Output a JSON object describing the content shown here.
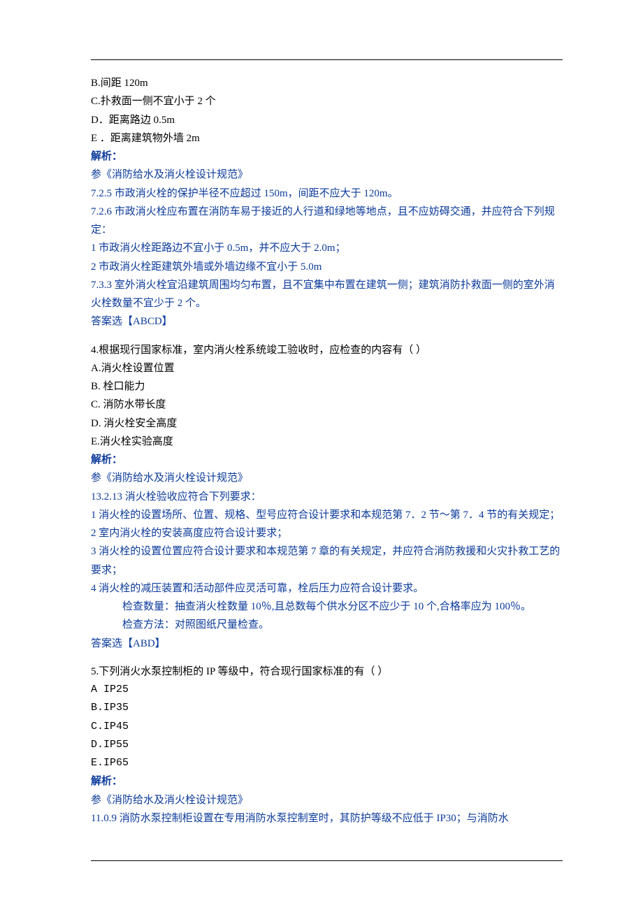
{
  "q3": {
    "optB": "B.间距 120m",
    "optC": "C.扑救面一侧不宜小于 2 个",
    "optD": "D．距离路边 0.5m",
    "optE": "E ．距离建筑物外墙 2m",
    "analysisLabel": "解析：",
    "refLine": "参《消防给水及消火栓设计规范》",
    "a1": "7.2.5 市政消火栓的保护半径不应超过 150m，间距不应大于 120m。",
    "a2": "7.2.6 市政消火栓应布置在消防车易于接近的人行道和绿地等地点，且不应妨碍交通，并应符合下列规定：",
    "a3": "1 市政消火栓距路边不宜小于 0.5m，并不应大于 2.0m；",
    "a4": "2 市政消火栓距建筑外墙或外墙边缘不宜小于 5.0m",
    "a5": "7.3.3 室外消火栓宜沿建筑周围均匀布置，且不宜集中布置在建筑一侧；建筑消防扑救面一侧的室外消火栓数量不宜少于 2 个。",
    "answer": "答案选【ABCD】"
  },
  "q4": {
    "stem": "4.根据现行国家标准，室内消火栓系统竣工验收时，应检查的内容有（  ）",
    "optA": "A.消火栓设置位置",
    "optB": "B. 栓口能力",
    "optC": "C. 消防水带长度",
    "optD": "D. 消火栓安全高度",
    "optE": "E.消火栓实验高度",
    "analysisLabel": "解析：",
    "refLine": "参《消防给水及消火栓设计规范》",
    "a1": "13.2.13 消火栓验收应符合下列要求：",
    "a2": "1 消火栓的设置场所、位置、规格、型号应符合设计要求和本规范第 7．2 节～第 7．4 节的有关规定；",
    "a3": "2 室内消火栓的安装高度应符合设计要求；",
    "a4": "3 消火栓的设置位置应符合设计要求和本规范第 7 章的有关规定，并应符合消防救援和火灾扑救工艺的要求；",
    "a5": "4 消火栓的减压装置和活动部件应灵活可靠，栓后压力应符合设计要求。",
    "a6": "检查数量：抽查消火栓数量 10％,且总数每个供水分区不应少于 10 个,合格率应为 100％。",
    "a7": "检查方法：对照图纸尺量检查。",
    "answer": "答案选【ABD】"
  },
  "q5": {
    "stem": "5.下列消火水泵控制柜的 IP 等级中，符合现行国家标准的有（  ）",
    "optA": "A IP25",
    "optB": "B.IP35",
    "optC": "C.IP45",
    "optD": "D.IP55",
    "optE": "E.IP65",
    "analysisLabel": "解析：",
    "refLine": "参《消防给水及消火栓设计规范》",
    "a1": "11.0.9 消防水泵控制柜设置在专用消防水泵控制室时，其防护等级不应低于 IP30；与消防水"
  }
}
